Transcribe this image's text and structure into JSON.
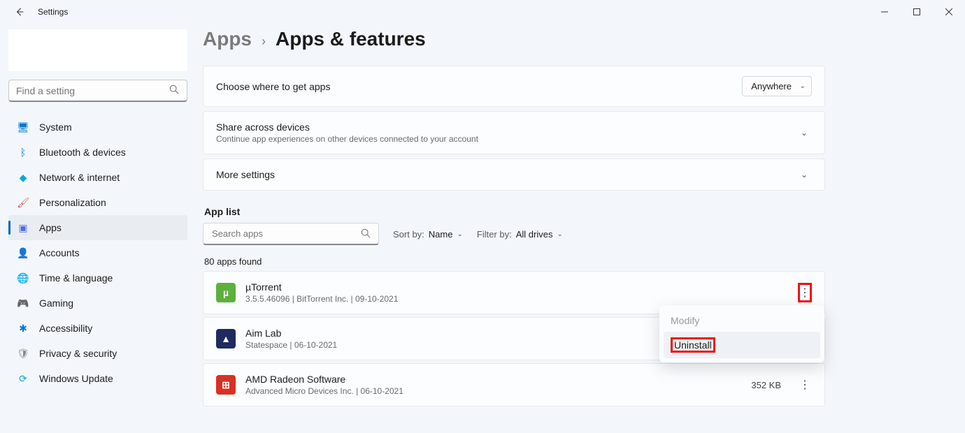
{
  "window": {
    "title": "Settings"
  },
  "search": {
    "placeholder": "Find a setting"
  },
  "nav": [
    {
      "label": "System",
      "icon": "monitor-icon",
      "color": "#0078d4"
    },
    {
      "label": "Bluetooth & devices",
      "icon": "bluetooth-icon",
      "color": "#0078d4"
    },
    {
      "label": "Network & internet",
      "icon": "wifi-icon",
      "color": "#0aa8d8"
    },
    {
      "label": "Personalization",
      "icon": "brush-icon",
      "color": "#c9544f"
    },
    {
      "label": "Apps",
      "icon": "apps-icon",
      "color": "#4f6bed",
      "selected": true
    },
    {
      "label": "Accounts",
      "icon": "person-icon",
      "color": "#0078d4"
    },
    {
      "label": "Time & language",
      "icon": "globe-icon",
      "color": "#00a2ad"
    },
    {
      "label": "Gaming",
      "icon": "game-icon",
      "color": "#888"
    },
    {
      "label": "Accessibility",
      "icon": "accessibility-icon",
      "color": "#0078d4"
    },
    {
      "label": "Privacy & security",
      "icon": "shield-icon",
      "color": "#888"
    },
    {
      "label": "Windows Update",
      "icon": "update-icon",
      "color": "#0aa8d8"
    }
  ],
  "breadcrumb": {
    "root": "Apps",
    "leaf": "Apps & features"
  },
  "cards": {
    "choose_apps": {
      "title": "Choose where to get apps",
      "value": "Anywhere"
    },
    "share": {
      "title": "Share across devices",
      "sub": "Continue app experiences on other devices connected to your account"
    },
    "more": {
      "title": "More settings"
    }
  },
  "applist": {
    "section_label": "App list",
    "search_placeholder": "Search apps",
    "sort_label": "Sort by:",
    "sort_value": "Name",
    "filter_label": "Filter by:",
    "filter_value": "All drives",
    "count": "80 apps found"
  },
  "apps": [
    {
      "name": "µTorrent",
      "meta": "3.5.5.46096   |   BitTorrent Inc.   |   09-10-2021",
      "size": "",
      "icon_bg": "#5cb03b",
      "icon_letter": "µ",
      "highlight_more": true,
      "show_menu": true
    },
    {
      "name": "Aim Lab",
      "meta": "Statespace   |   06-10-2021",
      "size": "",
      "icon_bg": "#1f2b5f",
      "icon_letter": "▲"
    },
    {
      "name": "AMD Radeon Software",
      "meta": "Advanced Micro Devices Inc.   |   06-10-2021",
      "size": "352 KB",
      "icon_bg": "#d93025",
      "icon_letter": "⊞"
    }
  ],
  "ctx": {
    "modify": "Modify",
    "uninstall": "Uninstall"
  }
}
